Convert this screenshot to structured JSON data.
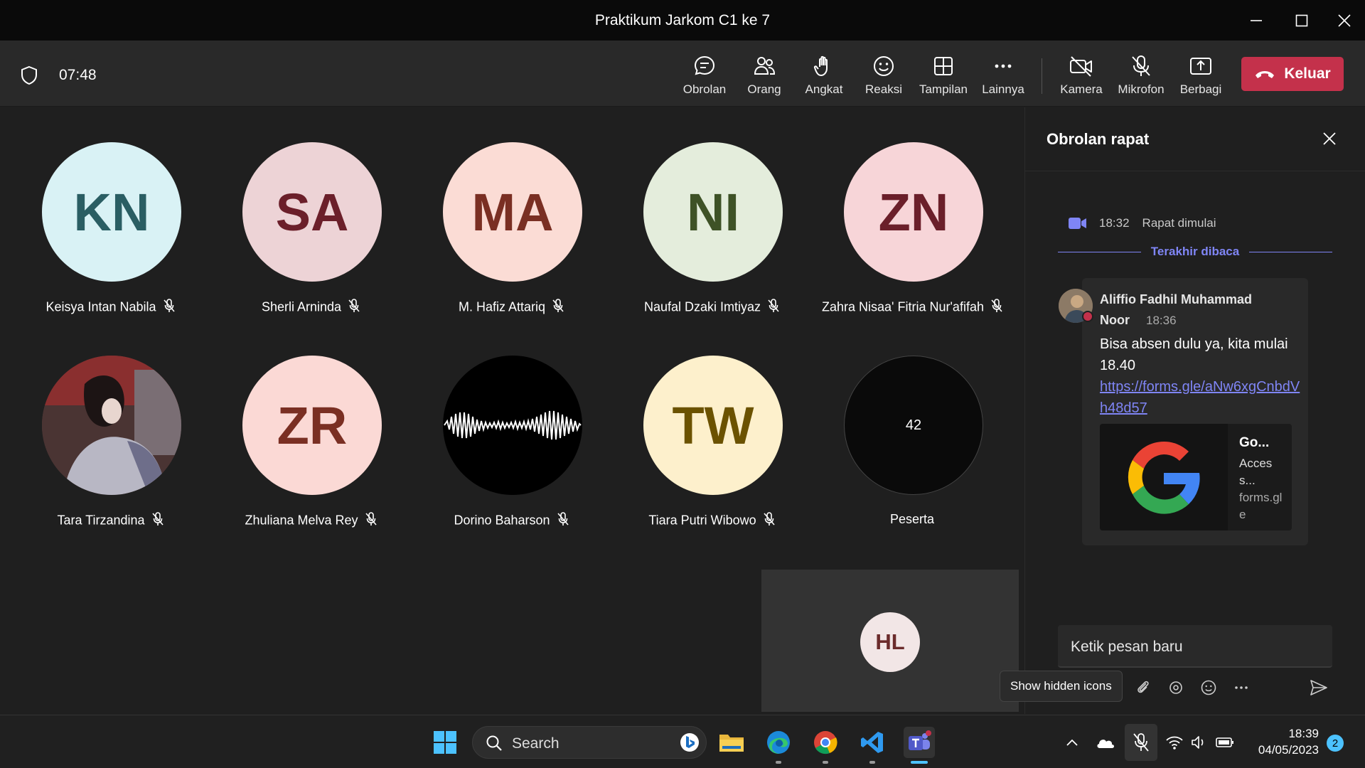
{
  "window": {
    "title": "Praktikum Jarkom C1 ke 7"
  },
  "toolbar": {
    "elapsed": "07:48",
    "buttons": {
      "chat": "Obrolan",
      "people": "Orang",
      "raise": "Angkat",
      "react": "Reaksi",
      "view": "Tampilan",
      "more": "Lainnya",
      "camera": "Kamera",
      "mic": "Mikrofon",
      "share": "Berbagi"
    },
    "leave": "Keluar"
  },
  "participants": [
    {
      "initials": "KN",
      "name": "Keisya Intan Nabila",
      "bg": "#d9f2f5",
      "fg": "#2a5e63"
    },
    {
      "initials": "SA",
      "name": "Sherli Arninda",
      "bg": "#edd3d6",
      "fg": "#6b1f2a"
    },
    {
      "initials": "MA",
      "name": "M. Hafiz Attariq",
      "bg": "#fbdcd5",
      "fg": "#7a2f23"
    },
    {
      "initials": "NI",
      "name": "Naufal Dzaki Imtiyaz",
      "bg": "#e4eddc",
      "fg": "#3e5226"
    },
    {
      "initials": "ZN",
      "name": "Zahra Nisaa' Fitria Nur'afifah",
      "bg": "#f7d5d8",
      "fg": "#6b1f2a"
    },
    {
      "initials": "",
      "name": "Tara Tirzandina",
      "bg": "#6b4a46",
      "fg": "#fff"
    },
    {
      "initials": "ZR",
      "name": "Zhuliana Melva Rey",
      "bg": "#fbd9d5",
      "fg": "#7a2f23"
    },
    {
      "initials": "",
      "name": "Dorino Baharson",
      "bg": "#000000",
      "fg": "#fff"
    },
    {
      "initials": "TW",
      "name": "Tiara Putri Wibowo",
      "bg": "#fdf0cc",
      "fg": "#6b5200"
    }
  ],
  "overflow": {
    "count": "42",
    "label": "Peserta"
  },
  "self": {
    "initials": "HL"
  },
  "chat": {
    "title": "Obrolan rapat",
    "system": {
      "time": "18:32",
      "text": "Rapat dimulai"
    },
    "last_read": "Terakhir dibaca",
    "message": {
      "sender_line1": "Aliffio Fadhil Muhammad",
      "sender_line2": "Noor",
      "time": "18:36",
      "text": "Bisa absen dulu ya, kita mulai 18.40",
      "link": "https://forms.gle/aNw6xgCnbdVh48d57",
      "preview": {
        "title": "Go...",
        "desc": "Access...",
        "host": "forms.gle"
      }
    },
    "compose_placeholder": "Ketik pesan baru"
  },
  "tooltip": "Show hidden icons",
  "taskbar": {
    "search": "Search",
    "time": "18:39",
    "date": "04/05/2023",
    "notifications": "2"
  }
}
